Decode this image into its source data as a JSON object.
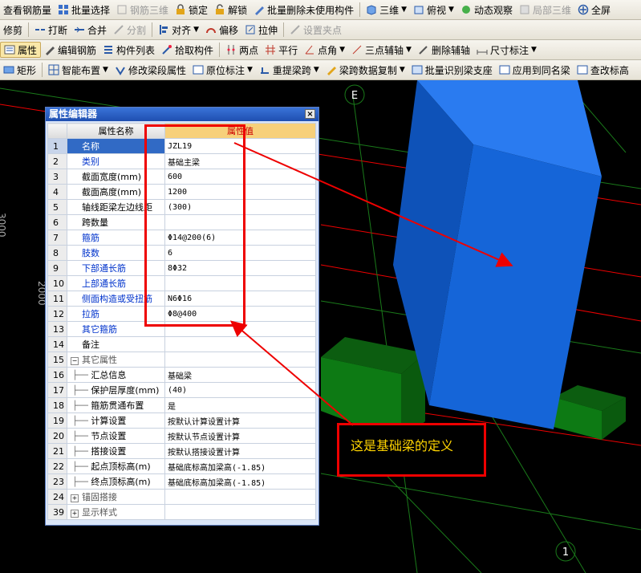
{
  "toolbar1": {
    "items": [
      "查看钢筋量",
      "批量选择",
      "钢筋三维",
      "锁定",
      "解锁",
      "批量删除未使用构件",
      "三维",
      "俯视",
      "动态观察",
      "局部三维",
      "全屏"
    ]
  },
  "toolbar2": {
    "items": [
      "修剪",
      "打断",
      "合并",
      "分割",
      "对齐",
      "偏移",
      "拉伸",
      "设置夹点"
    ]
  },
  "toolbar3": {
    "items": [
      "属性",
      "编辑钢筋",
      "构件列表",
      "拾取构件",
      "两点",
      "平行",
      "点角",
      "三点辅轴",
      "删除辅轴",
      "尺寸标注"
    ]
  },
  "toolbar4": {
    "items": [
      "矩形",
      "智能布置",
      "修改梁段属性",
      "原位标注",
      "重提梁跨",
      "梁跨数据复制",
      "批量识别梁支座",
      "应用到同名梁",
      "查改标高"
    ]
  },
  "viewport": {
    "axis_labels": [
      "E",
      "1"
    ],
    "side_labels": [
      "3000",
      "2000"
    ]
  },
  "editor": {
    "title": "属性编辑器",
    "close": "×",
    "col_name": "属性名称",
    "col_value": "属性值",
    "rows": [
      {
        "num": "1",
        "name": "名称",
        "value": "JZL19",
        "style": "sel"
      },
      {
        "num": "2",
        "name": "类别",
        "value": "基础主梁",
        "style": "blue"
      },
      {
        "num": "3",
        "name": "截面宽度(mm)",
        "value": "600",
        "style": ""
      },
      {
        "num": "4",
        "name": "截面高度(mm)",
        "value": "1200",
        "style": ""
      },
      {
        "num": "5",
        "name": "轴线距梁左边线距",
        "value": "(300)",
        "style": ""
      },
      {
        "num": "6",
        "name": "跨数量",
        "value": "",
        "style": ""
      },
      {
        "num": "7",
        "name": "箍筋",
        "value": "Φ14@200(6)",
        "style": "blue"
      },
      {
        "num": "8",
        "name": "肢数",
        "value": "6",
        "style": "blue"
      },
      {
        "num": "9",
        "name": "下部通长筋",
        "value": "8Φ32",
        "style": "blue"
      },
      {
        "num": "10",
        "name": "上部通长筋",
        "value": "",
        "style": "blue"
      },
      {
        "num": "11",
        "name": "侧面构造或受扭筋",
        "value": "N6Φ16",
        "style": "blue"
      },
      {
        "num": "12",
        "name": "拉筋",
        "value": "Φ8@400",
        "style": "blue"
      },
      {
        "num": "13",
        "name": "其它箍筋",
        "value": "",
        "style": "blue"
      },
      {
        "num": "14",
        "name": "备注",
        "value": "",
        "style": ""
      },
      {
        "num": "15",
        "name": "其它属性",
        "value": "",
        "style": "group-open"
      },
      {
        "num": "16",
        "name": "汇总信息",
        "value": "基础梁",
        "style": "tree"
      },
      {
        "num": "17",
        "name": "保护层厚度(mm)",
        "value": "(40)",
        "style": "tree"
      },
      {
        "num": "18",
        "name": "箍筋贯通布置",
        "value": "是",
        "style": "tree"
      },
      {
        "num": "19",
        "name": "计算设置",
        "value": "按默认计算设置计算",
        "style": "tree"
      },
      {
        "num": "20",
        "name": "节点设置",
        "value": "按默认节点设置计算",
        "style": "tree"
      },
      {
        "num": "21",
        "name": "搭接设置",
        "value": "按默认搭接设置计算",
        "style": "tree"
      },
      {
        "num": "22",
        "name": "起点顶标高(m)",
        "value": "基础底标高加梁高(-1.85)",
        "style": "tree"
      },
      {
        "num": "23",
        "name": "终点顶标高(m)",
        "value": "基础底标高加梁高(-1.85)",
        "style": "tree"
      },
      {
        "num": "24",
        "name": "锚固搭接",
        "value": "",
        "style": "group-closed"
      },
      {
        "num": "39",
        "name": "显示样式",
        "value": "",
        "style": "group-closed"
      }
    ]
  },
  "annotation": {
    "callout_text": "这是基础梁的定义"
  },
  "colors": {
    "beam_blue": "#1565d8",
    "support_green": "#0a7a12",
    "annot_red": "#ee0000",
    "callout_yellow": "#ffd400"
  }
}
